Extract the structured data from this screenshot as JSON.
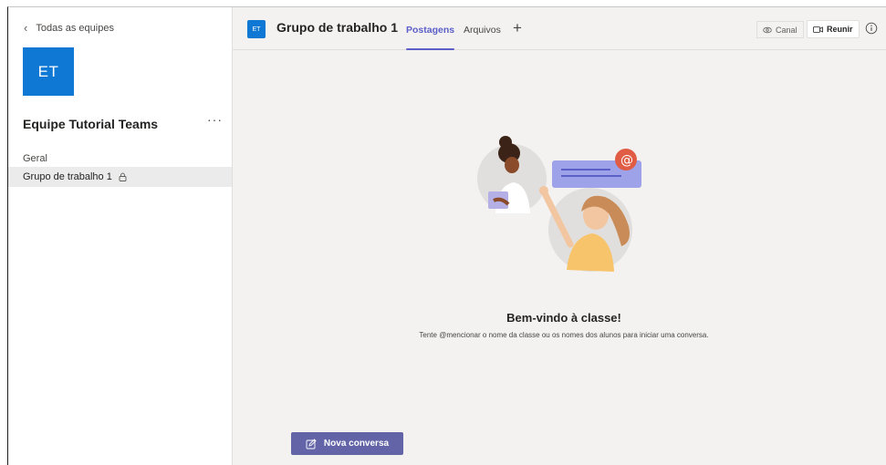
{
  "sidebar": {
    "back_label": "Todas as equipes",
    "team_initials": "ET",
    "team_name": "Equipe Tutorial Teams",
    "more_label": "···",
    "channels": [
      {
        "label": "Geral"
      },
      {
        "label": "Grupo de trabalho 1"
      }
    ]
  },
  "header": {
    "channel_initials": "ET",
    "channel_title": "Grupo de trabalho 1",
    "tabs": [
      {
        "label": "Postagens"
      },
      {
        "label": "Arquivos"
      }
    ],
    "add_tab_label": "+",
    "canal_label": "Canal",
    "reunir_label": "Reunir"
  },
  "main": {
    "welcome_title": "Bem-vindo à classe!",
    "welcome_subtitle": "Tente @mencionar o nome da classe ou os nomes dos alunos para iniciar uma conversa.",
    "new_conversation_label": "Nova conversa"
  },
  "colors": {
    "accent": "#5b5fc7",
    "team_tile": "#0f78d4",
    "button": "#6264a7"
  },
  "icons": [
    "chevron-left-icon",
    "lock-icon",
    "eye-icon",
    "meet-icon",
    "info-icon",
    "compose-icon"
  ]
}
